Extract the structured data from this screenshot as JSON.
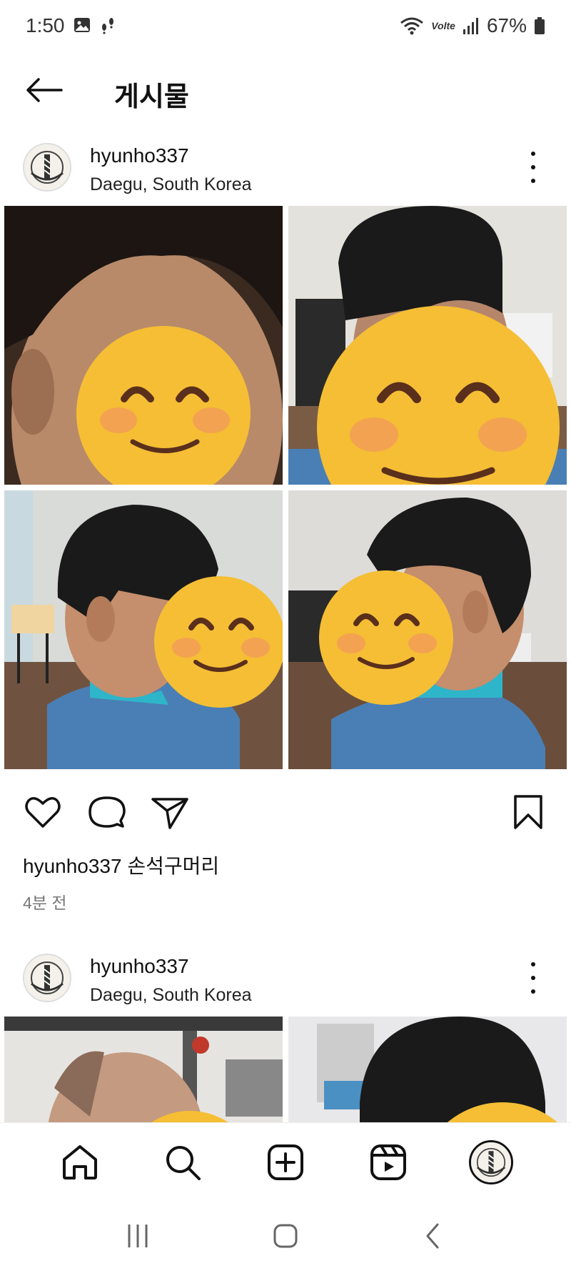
{
  "status_bar": {
    "time": "1:50",
    "battery": "67%",
    "network_label": "Volte"
  },
  "header": {
    "title": "게시물"
  },
  "posts": [
    {
      "username": "hyunho337",
      "location": "Daegu, South Korea",
      "caption_user": "hyunho337",
      "caption_text": "손석구머리",
      "time_ago": "4분 전"
    },
    {
      "username": "hyunho337",
      "location": "Daegu, South Korea"
    }
  ],
  "nav": {
    "items": [
      "home-icon",
      "search-icon",
      "create-icon",
      "reels-icon",
      "profile-avatar"
    ]
  },
  "colors": {
    "emoji": "#F7C43A",
    "emoji_blush": "#F39A5D",
    "shirt_blue": "#4A7FB5",
    "hair": "#1a1a1a"
  }
}
